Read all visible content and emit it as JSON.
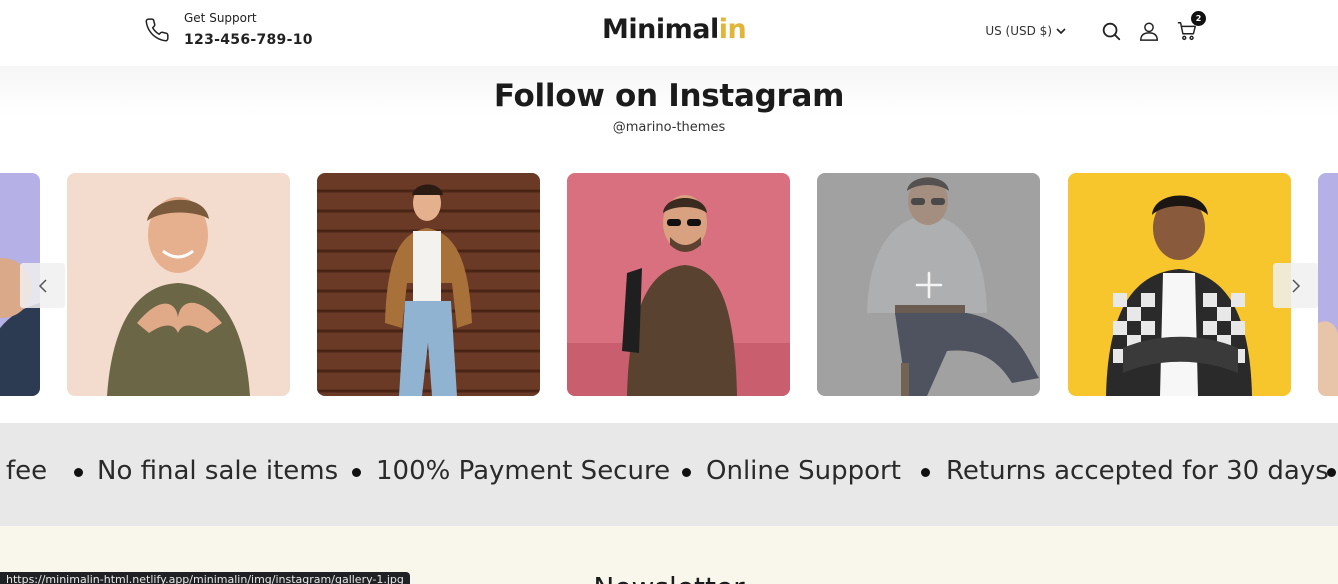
{
  "header": {
    "support_label": "Get Support",
    "support_phone": "123-456-789-10",
    "logo_main": "Minimal",
    "logo_accent": "in",
    "currency": "US (USD $)",
    "cart_count": "2",
    "icons": [
      "phone-icon",
      "chevron-down-icon",
      "search-icon",
      "user-icon",
      "cart-icon"
    ]
  },
  "instagram": {
    "title": "Follow on Instagram",
    "handle": "@marino-themes",
    "tiles": [
      {
        "bg": "#b5b0e6"
      },
      {
        "bg": "#f3dccd"
      },
      {
        "bg": "#6a3a26"
      },
      {
        "bg": "#d9707f"
      },
      {
        "bg": "#d2d2d2"
      },
      {
        "bg": "#f7c52c"
      },
      {
        "bg": "#b5b0e6"
      }
    ],
    "prev_icon": "chevron-left-icon",
    "next_icon": "chevron-right-icon",
    "hover_icon": "plus-icon"
  },
  "marquee": {
    "items": [
      "fee",
      "No final sale items",
      "100% Payment Secure",
      "Online Support",
      "Returns accepted for 30 days"
    ]
  },
  "newsletter": {
    "title": "Newsletter"
  },
  "status_bar": {
    "url": "https://minimalin-html.netlify.app/minimalin/img/instagram/gallery-1.jpg"
  },
  "colors": {
    "accent": "#e3b43a",
    "marquee_bg": "#e8e8e8",
    "newsletter_bg": "#f9f6ec"
  }
}
